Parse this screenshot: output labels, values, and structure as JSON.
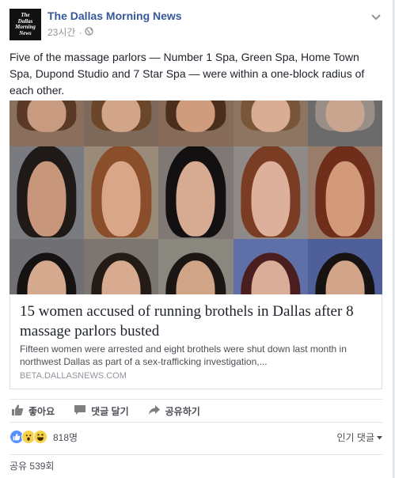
{
  "post": {
    "page_name": "The Dallas Morning News",
    "logo_text": [
      "The",
      "Dallas",
      "Morning",
      "News"
    ],
    "time": "23시간",
    "separator": "·",
    "privacy_icon": "globe-icon",
    "menu_icon": "chevron-down-icon",
    "text": "Five of the massage parlors — Number 1 Spa, Green Spa, Home Town Spa, Dupond Studio and 7 Star Spa — were within a one-block radius of each other."
  },
  "image": {
    "rows": [
      [
        {
          "bg": "#8a6f5c",
          "skin": "#c89a80",
          "hair": "#5a3a26"
        },
        {
          "bg": "#7d6a5a",
          "skin": "#d2a48a",
          "hair": "#6b4628"
        },
        {
          "bg": "#866c58",
          "skin": "#cf9c7e",
          "hair": "#4a2f1e"
        },
        {
          "bg": "#8d7562",
          "skin": "#d8ad93",
          "hair": "#7a5638"
        },
        {
          "bg": "#6c6b6b",
          "skin": "#c9a48e",
          "hair": "#9a8f87"
        }
      ],
      [
        {
          "bg": "#7a7b80",
          "skin": "#c8967b",
          "hair": "#1f1a18"
        },
        {
          "bg": "#9a8a7a",
          "skin": "#d9a688",
          "hair": "#8a4e2a"
        },
        {
          "bg": "#7f7875",
          "skin": "#d6ab92",
          "hair": "#121010"
        },
        {
          "bg": "#8f8a87",
          "skin": "#dcb09a",
          "hair": "#7a3c22"
        },
        {
          "bg": "#9a7c6a",
          "skin": "#d39a7a",
          "hair": "#6e2e1a"
        }
      ],
      [
        {
          "bg": "#6f6f74",
          "skin": "#d4a98e",
          "hair": "#161212"
        },
        {
          "bg": "#7c7670",
          "skin": "#d8ab90",
          "hair": "#241a16"
        },
        {
          "bg": "#8a877f",
          "skin": "#cfa487",
          "hair": "#1b1614"
        },
        {
          "bg": "#5f6fa8",
          "skin": "#d9ad97",
          "hair": "#4a1e1e"
        },
        {
          "bg": "#4f5f9a",
          "skin": "#d2a58a",
          "hair": "#171313"
        }
      ]
    ]
  },
  "link": {
    "title": "15 women accused of running brothels in Dallas after 8 massage parlors busted",
    "description": "Fifteen women were arrested and eight brothels were shut down last month in northwest Dallas as part of a sex-trafficking investigation,...",
    "domain": "BETA.DALLASNEWS.COM"
  },
  "actions": {
    "like_label": "좋아요",
    "comment_label": "댓글 달기",
    "share_label": "공유하기"
  },
  "reactions": {
    "icons": [
      "like-icon",
      "wow-icon",
      "haha-icon"
    ],
    "count": "818명",
    "sort_label": "인기 댓글"
  },
  "shares": {
    "label": "공유 539회"
  },
  "colors": {
    "link_blue": "#365899",
    "meta_gray": "#90949c",
    "like_blue": "#5890ff"
  }
}
